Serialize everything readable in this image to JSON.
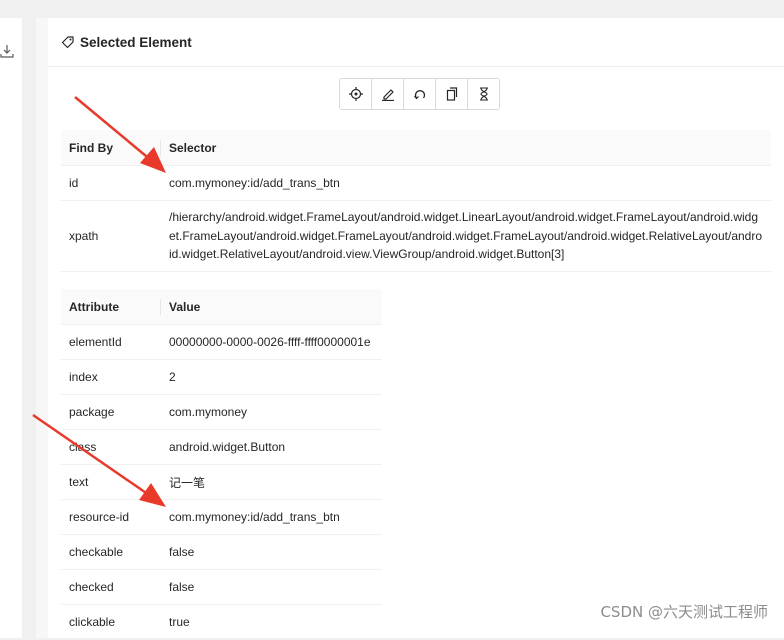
{
  "panel": {
    "title": "Selected Element"
  },
  "toolbar": {
    "buttons": [
      {
        "icon": "crosshair-icon",
        "name": "tap"
      },
      {
        "icon": "pencil-icon",
        "name": "send-keys"
      },
      {
        "icon": "undo-icon",
        "name": "clear"
      },
      {
        "icon": "copy-icon",
        "name": "copy-attributes"
      },
      {
        "icon": "hourglass-icon",
        "name": "get-timing"
      }
    ]
  },
  "selectors": {
    "headers": [
      "Find By",
      "Selector"
    ],
    "rows": [
      {
        "find_by": "id",
        "selector": "com.mymoney:id/add_trans_btn"
      },
      {
        "find_by": "xpath",
        "selector": "/hierarchy/android.widget.FrameLayout/android.widget.LinearLayout/android.widget.FrameLayout/android.widget.FrameLayout/android.widget.FrameLayout/android.widget.FrameLayout/android.widget.RelativeLayout/android.widget.RelativeLayout/android.view.ViewGroup/android.widget.Button[3]"
      }
    ]
  },
  "attributes": {
    "headers": [
      "Attribute",
      "Value"
    ],
    "rows": [
      {
        "name": "elementId",
        "value": "00000000-0000-0026-ffff-ffff0000001e"
      },
      {
        "name": "index",
        "value": "2"
      },
      {
        "name": "package",
        "value": "com.mymoney"
      },
      {
        "name": "class",
        "value": "android.widget.Button"
      },
      {
        "name": "text",
        "value": "记一笔"
      },
      {
        "name": "resource-id",
        "value": "com.mymoney:id/add_trans_btn"
      },
      {
        "name": "checkable",
        "value": "false"
      },
      {
        "name": "checked",
        "value": "false"
      },
      {
        "name": "clickable",
        "value": "true"
      }
    ]
  },
  "watermark": "CSDN @六天测试工程师",
  "colors": {
    "annotation_arrow": "#e8392b",
    "border": "#d9d9d9",
    "header_bg": "#fafafa"
  }
}
